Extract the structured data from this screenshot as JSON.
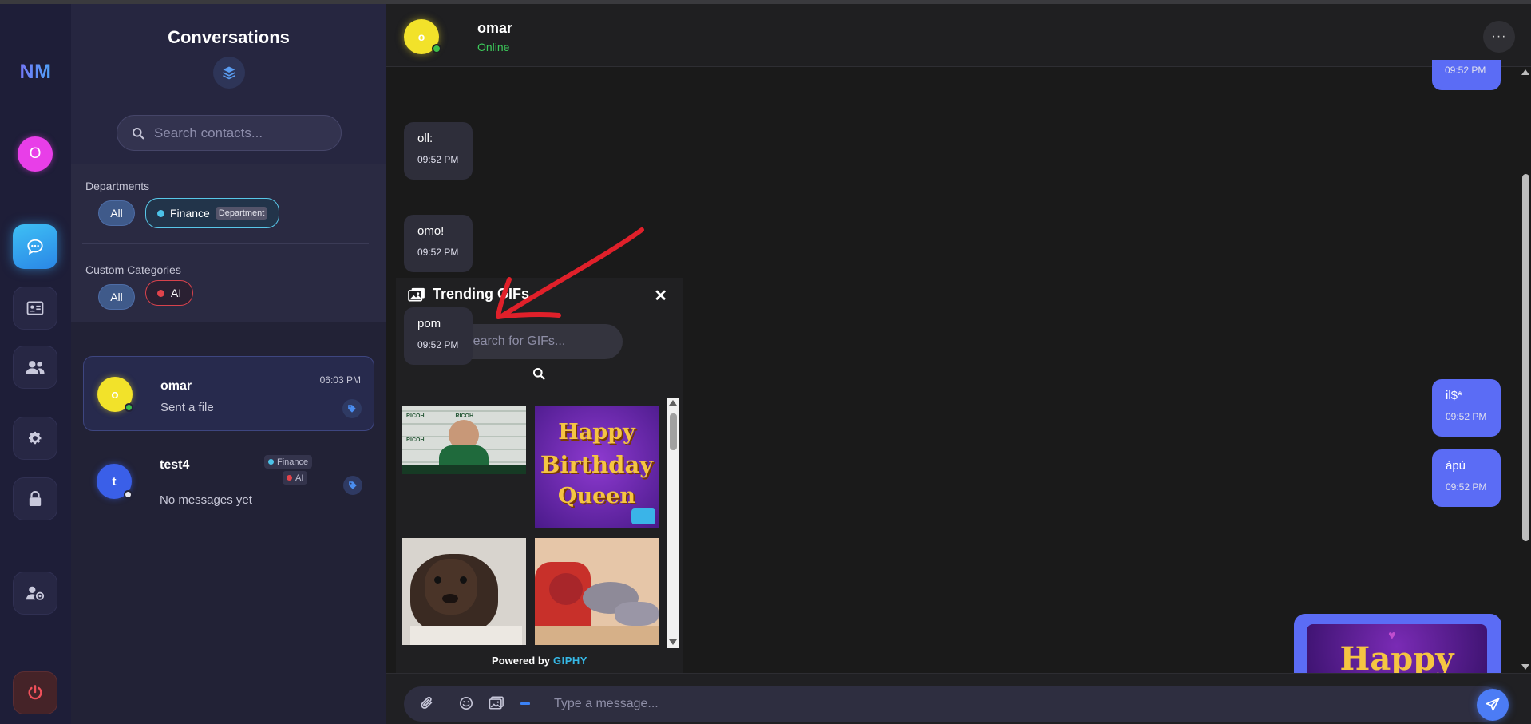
{
  "app": {
    "logo": "NM",
    "user_initial": "O"
  },
  "rail": {
    "items": [
      {
        "name": "chat-icon",
        "active": true
      },
      {
        "name": "id-card-icon",
        "active": false
      },
      {
        "name": "users-icon",
        "active": false
      },
      {
        "name": "gear-icon",
        "active": false
      },
      {
        "name": "lock-icon",
        "active": false
      },
      {
        "name": "user-settings-icon",
        "active": false
      },
      {
        "name": "power-icon",
        "active": false
      }
    ]
  },
  "conversations": {
    "title": "Conversations",
    "search_placeholder": "Search contacts...",
    "departments_label": "Departments",
    "departments": [
      {
        "label": "All",
        "selected": true
      },
      {
        "label": "Finance",
        "tag": "Department",
        "color": "#4cc3e8"
      }
    ],
    "categories_label": "Custom Categories",
    "categories": [
      {
        "label": "All",
        "selected": true
      },
      {
        "label": "AI",
        "color": "#e2434b"
      }
    ],
    "contacts": [
      {
        "initial": "o",
        "name": "omar",
        "last_message": "Sent a file",
        "time": "06:03 PM",
        "online": true,
        "avatar_color": "#f2e22a",
        "selected": true
      },
      {
        "initial": "t",
        "name": "test4",
        "last_message": "No messages yet",
        "time": "",
        "online": false,
        "avatar_color": "#3a5fe8",
        "tags": [
          {
            "label": "Finance",
            "color": "#4cc3e8"
          },
          {
            "label": "AI",
            "color": "#e2434b"
          }
        ]
      }
    ]
  },
  "chat": {
    "contact_name": "omar",
    "contact_initial": "o",
    "status": "Online",
    "more_label": "···",
    "messages": [
      {
        "direction": "out",
        "text": "",
        "time": "09:52 PM"
      },
      {
        "direction": "in",
        "text": "oll:",
        "time": "09:52 PM"
      },
      {
        "direction": "in",
        "text": "omo!",
        "time": "09:52 PM"
      },
      {
        "direction": "in",
        "text": "pom",
        "time": "09:52 PM"
      },
      {
        "direction": "out",
        "text": "il$*",
        "time": "09:52 PM"
      },
      {
        "direction": "out",
        "text": "àpù",
        "time": "09:52 PM"
      }
    ],
    "composer_placeholder": "Type a message...",
    "gif_preview_text": "Happy"
  },
  "gif_picker": {
    "title": "Trending GIFs",
    "close_label": "✕",
    "search_placeholder": "Search for GIFs...",
    "powered_by": "Powered by",
    "provider": "GIPHY",
    "gifs": [
      {
        "name": "gif-press-conference"
      },
      {
        "name": "gif-happy-birthday-queen",
        "line1": "Happy",
        "line2": "Birthday",
        "line3": "Queen"
      },
      {
        "name": "gif-dog"
      },
      {
        "name": "gif-cartoon-cat"
      }
    ]
  },
  "colors": {
    "accent": "#5b6cf5",
    "online": "#3cc95a",
    "annotation_arrow": "#e0202a"
  }
}
